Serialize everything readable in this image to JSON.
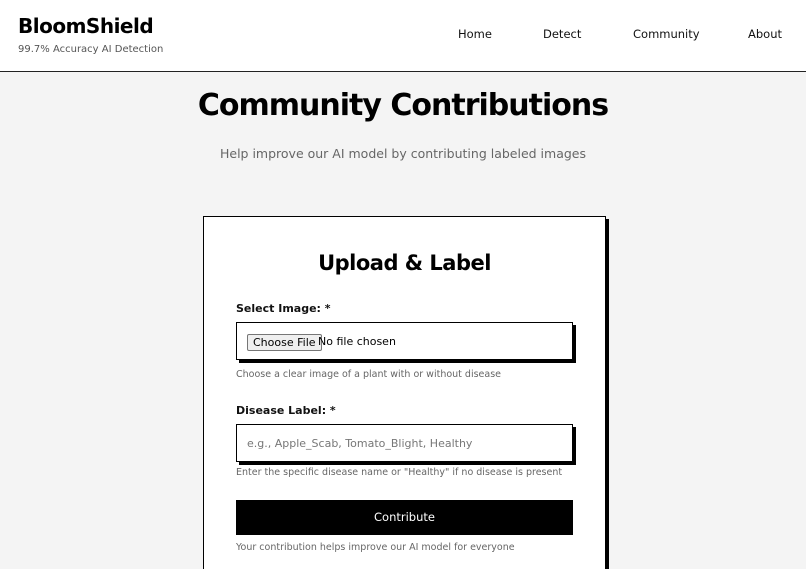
{
  "header": {
    "brand_name": "BloomShield",
    "brand_tagline": "99.7% Accuracy AI Detection",
    "nav": [
      "Home",
      "Detect",
      "Community",
      "About"
    ]
  },
  "page": {
    "title": "Community Contributions",
    "subtitle": "Help improve our AI model by contributing labeled images"
  },
  "form": {
    "title": "Upload & Label",
    "image_label": "Select Image: *",
    "file_button": "Choose File",
    "file_status": "No file chosen",
    "image_hint": "Choose a clear image of a plant with or without disease",
    "disease_label": "Disease Label: *",
    "disease_value": "",
    "disease_placeholder": "e.g., Apple_Scab, Tomato_Blight, Healthy",
    "disease_hint": "Enter the specific disease name or \"Healthy\" if no disease is present",
    "submit_label": "Contribute",
    "footer_note": "Your contribution helps improve our AI model for everyone"
  },
  "colors": {
    "background": "#f4f4f4",
    "surface": "#ffffff",
    "primary": "#000000",
    "muted_text": "#666666"
  }
}
